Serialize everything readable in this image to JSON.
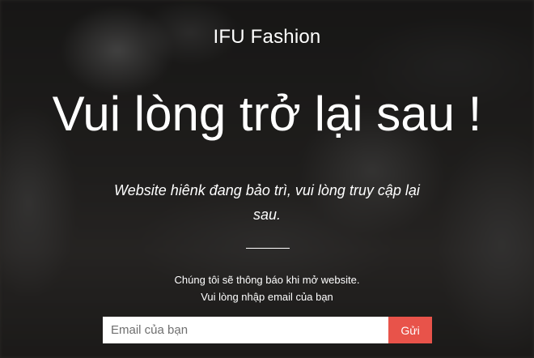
{
  "brand": "IFU Fashion",
  "headline": "Vui lòng trở lại sau !",
  "subtitle": "Website hiênk đang bảo trì, vui lòng truy cập lại sau.",
  "notify": {
    "line1": "Chúng tôi sẽ thông báo khi mở website.",
    "line2": "Vui lòng nhập email của bạn"
  },
  "form": {
    "email_placeholder": "Email của bạn",
    "email_value": "",
    "submit_label": "Gửi"
  },
  "colors": {
    "accent": "#e8534a",
    "text": "#ffffff",
    "background": "#2a2826"
  }
}
